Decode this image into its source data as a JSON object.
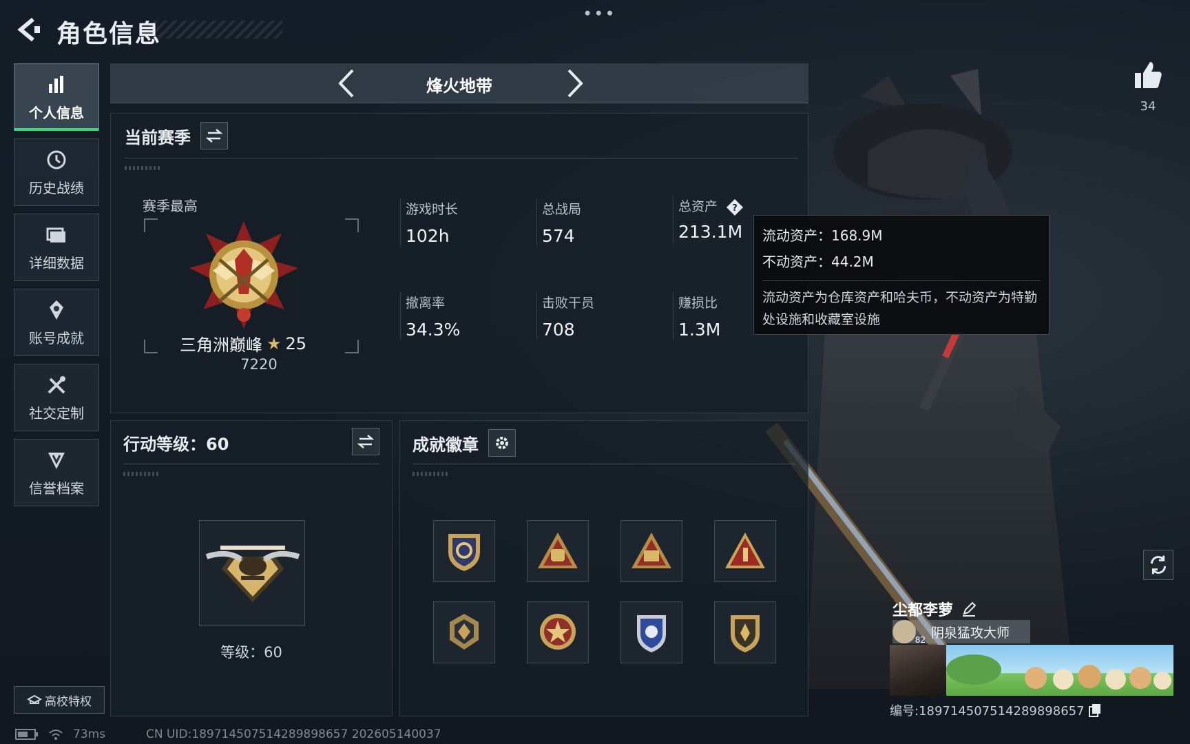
{
  "header": {
    "title": "角色信息",
    "more": "•••"
  },
  "nav": {
    "items": [
      {
        "label": "个人信息",
        "icon": "bar-chart-icon",
        "active": true
      },
      {
        "label": "历史战绩",
        "icon": "history-icon"
      },
      {
        "label": "详细数据",
        "icon": "folder-icon"
      },
      {
        "label": "账号成就",
        "icon": "achievement-icon"
      },
      {
        "label": "社交定制",
        "icon": "tools-icon"
      },
      {
        "label": "信誉档案",
        "icon": "shield-icon"
      }
    ],
    "school_label": "高校特权"
  },
  "mode": {
    "name": "烽火地带"
  },
  "season": {
    "title": "当前赛季",
    "best_label": "赛季最高",
    "rank_name": "三角洲巅峰",
    "rank_star": "★",
    "rank_stars": "25",
    "rank_score": "7220",
    "stats": [
      {
        "label": "游戏时长",
        "value": "102h"
      },
      {
        "label": "总战局",
        "value": "574"
      },
      {
        "label": "总资产",
        "value": "213.1M"
      },
      {
        "label": "撤离率",
        "value": "34.3%"
      },
      {
        "label": "击败干员",
        "value": "708"
      },
      {
        "label": "赚损比",
        "value": "1.3M"
      }
    ]
  },
  "tooltip": {
    "liquid": "流动资产：168.9M",
    "fixed": "不动资产：44.2M",
    "desc": "流动资产为仓库资产和哈夫币，不动资产为特勤处设施和收藏室设施"
  },
  "action_level": {
    "title": "行动等级：60",
    "level_text": "等级：60"
  },
  "badges": {
    "title": "成就徽章",
    "items": [
      "badge-1",
      "badge-2",
      "badge-3",
      "badge-4",
      "badge-5",
      "badge-6",
      "badge-7",
      "badge-8"
    ]
  },
  "likes": {
    "count": "34"
  },
  "player": {
    "name": "尘都李萝",
    "title": "阴泉猛攻大师",
    "title_level": "82",
    "uid": "编号:18971450751428989865​7"
  },
  "footer": {
    "ping": "73ms",
    "uid": "CN UID:189714507514289898657 202605140037"
  },
  "colors": {
    "accent": "#3fd27a",
    "gold": "#d8b968",
    "background": "#121a23"
  }
}
